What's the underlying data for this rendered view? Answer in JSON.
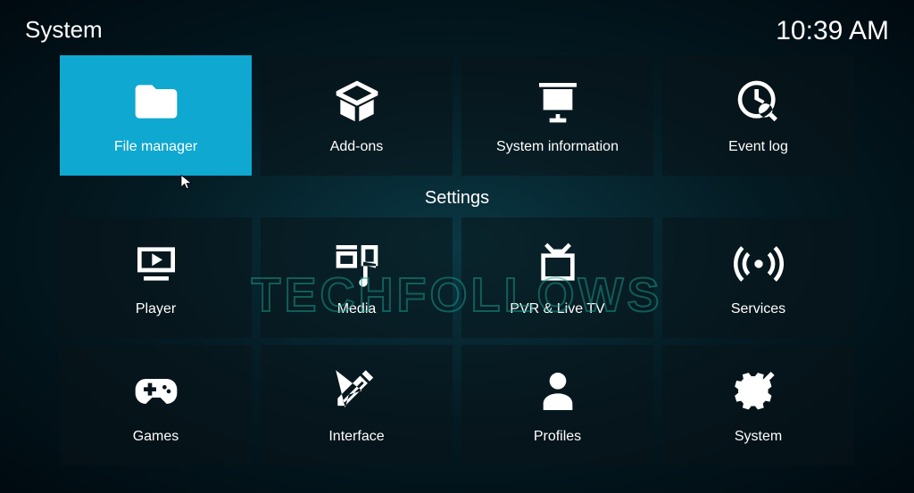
{
  "header": {
    "title": "System",
    "clock": "10:39 AM"
  },
  "topRow": [
    {
      "id": "file-manager",
      "label": "File manager",
      "selected": true
    },
    {
      "id": "add-ons",
      "label": "Add-ons",
      "selected": false
    },
    {
      "id": "system-information",
      "label": "System information",
      "selected": false
    },
    {
      "id": "event-log",
      "label": "Event log",
      "selected": false
    }
  ],
  "sectionTitle": "Settings",
  "settingsRow1": [
    {
      "id": "player",
      "label": "Player"
    },
    {
      "id": "media",
      "label": "Media"
    },
    {
      "id": "pvr-live-tv",
      "label": "PVR & Live TV"
    },
    {
      "id": "services",
      "label": "Services"
    }
  ],
  "settingsRow2": [
    {
      "id": "games",
      "label": "Games"
    },
    {
      "id": "interface",
      "label": "Interface"
    },
    {
      "id": "profiles",
      "label": "Profiles"
    },
    {
      "id": "system",
      "label": "System"
    }
  ],
  "watermark": "TECHFOLLOWS"
}
